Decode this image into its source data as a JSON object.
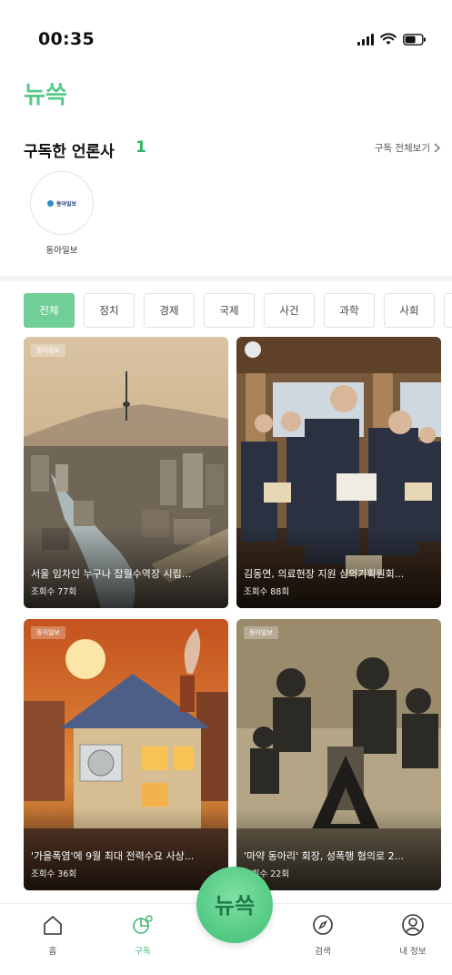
{
  "status_bar": {
    "time": "00:35"
  },
  "app": {
    "logo_text": "뉴쓱"
  },
  "subscribed": {
    "title": "구독한 언론사",
    "count": "1",
    "view_all": "구독 전체보기",
    "publishers": [
      {
        "name": "동아일보",
        "logo_text": "동아일보"
      }
    ]
  },
  "tabs": [
    {
      "label": "전체",
      "active": true
    },
    {
      "label": "정치",
      "active": false
    },
    {
      "label": "경제",
      "active": false
    },
    {
      "label": "국제",
      "active": false
    },
    {
      "label": "사건",
      "active": false
    },
    {
      "label": "과학",
      "active": false
    },
    {
      "label": "사회",
      "active": false
    }
  ],
  "news": [
    {
      "badge": "동아일보",
      "headline": "서울 임차인 누구나 잡월수역장 시립...",
      "views": "조회수 77회"
    },
    {
      "badge": "",
      "headline": "김동연, 의료현장 지원 심의기획원회...",
      "views": "조회수 88회"
    },
    {
      "badge": "동아일보",
      "headline": "'가을폭염'에 9월 최대 전력수요 사상...",
      "views": "조회수 36회"
    },
    {
      "badge": "동아일보",
      "headline": "'마약 동아리' 회장, 성폭행 혐의로 2...",
      "views": "조회수 22회"
    }
  ],
  "bottom_nav": [
    {
      "label": "홈",
      "icon": "home-icon",
      "active": false
    },
    {
      "label": "구독",
      "icon": "subscribe-icon",
      "active": true
    },
    {
      "label": "검색",
      "icon": "compass-icon",
      "active": false
    },
    {
      "label": "내 정보",
      "icon": "profile-icon",
      "active": false
    }
  ],
  "center_button": {
    "text": "뉴쓱"
  },
  "colors": {
    "brand": "#3fbf74",
    "active_tab": "#6fcf97",
    "count": "#34b36b"
  }
}
